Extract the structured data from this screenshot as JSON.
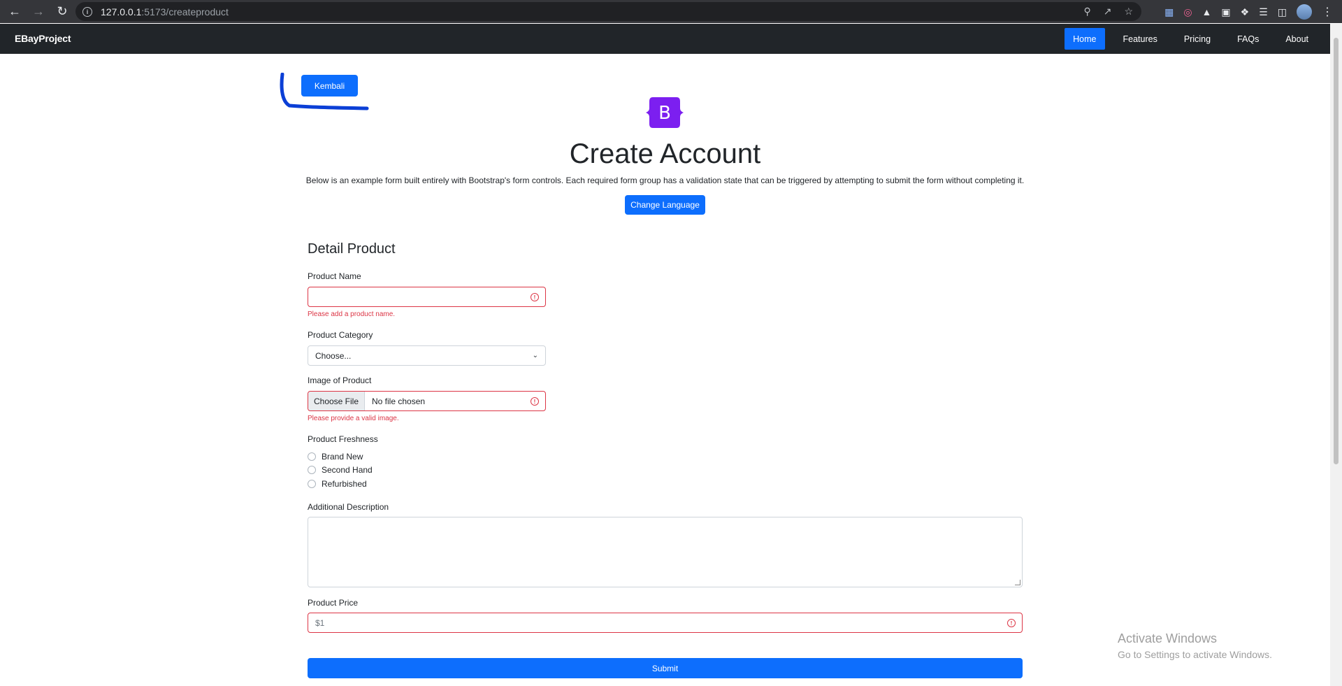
{
  "browser": {
    "url_host": "127.0.0.1",
    "url_path": ":5173/createproduct"
  },
  "navbar": {
    "brand": "EBayProject",
    "links": [
      {
        "label": "Home",
        "active": true
      },
      {
        "label": "Features",
        "active": false
      },
      {
        "label": "Pricing",
        "active": false
      },
      {
        "label": "FAQs",
        "active": false
      },
      {
        "label": "About",
        "active": false
      }
    ]
  },
  "page": {
    "back_button": "Kembali",
    "logo_letter": "B",
    "title": "Create Account",
    "lead": "Below is an example form built entirely with Bootstrap's form controls. Each required form group has a validation state that can be triggered by attempting to submit the form without completing it.",
    "change_language": "Change Language"
  },
  "form": {
    "heading": "Detail Product",
    "product_name": {
      "label": "Product Name",
      "value": "",
      "error": "Please add a product name."
    },
    "product_category": {
      "label": "Product Category",
      "selected": "Choose..."
    },
    "image": {
      "label": "Image of Product",
      "button": "Choose File",
      "status": "No file chosen",
      "error": "Please provide a valid image."
    },
    "freshness": {
      "label": "Product Freshness",
      "options": [
        "Brand New",
        "Second Hand",
        "Refurbished"
      ]
    },
    "description": {
      "label": "Additional Description",
      "value": ""
    },
    "price": {
      "label": "Product Price",
      "placeholder": "$1"
    },
    "submit": "Submit"
  },
  "watermark": {
    "line1": "Activate Windows",
    "line2": "Go to Settings to activate Windows."
  },
  "colors": {
    "primary": "#0d6efd",
    "danger": "#dc3545",
    "navbar_bg": "#212529",
    "logo_purple": "#7c1ff0"
  }
}
